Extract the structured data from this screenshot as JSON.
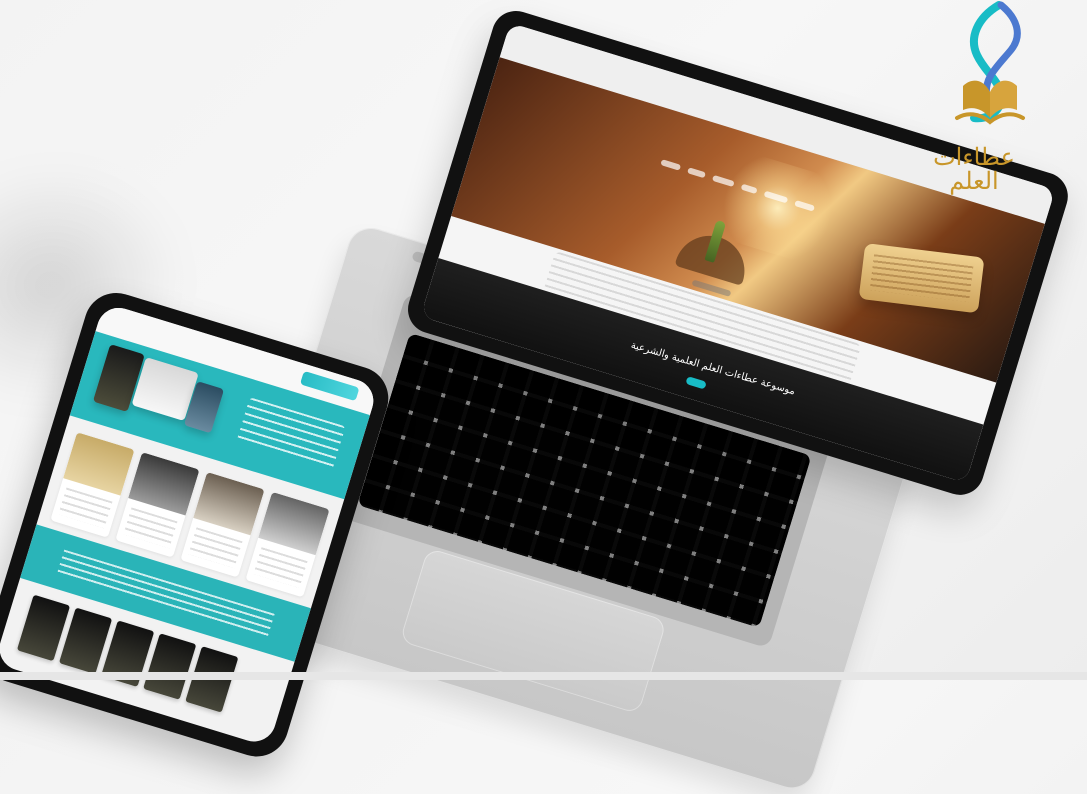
{
  "brand": {
    "arabic_name": "عطاءات العلم",
    "colors": {
      "teal": "#18bcc6",
      "blue": "#4c79d0",
      "gold": "#c8962a"
    }
  },
  "laptop": {
    "screen_caption": "موسوعة عطاءات العلم العلمية والشرعية"
  },
  "icons": {
    "brand_mark": "book-logo-icon"
  }
}
